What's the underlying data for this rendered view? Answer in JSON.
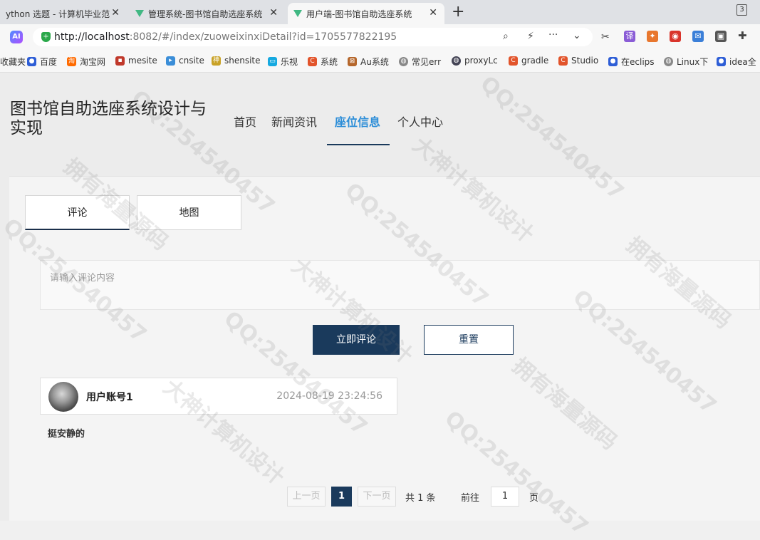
{
  "browser": {
    "tabs": [
      {
        "title": "ython 选题 - 计算机毕业范",
        "close": "✕"
      },
      {
        "title": "管理系统-图书馆自助选座系统",
        "close": "✕"
      },
      {
        "title": "用户端-图书馆自助选座系统",
        "close": "✕"
      }
    ],
    "new_tab": "+",
    "tab_count": "3",
    "url_host": "http://localhost",
    "url_rest": ":8082/#/index/zuoweixinxiDetail?id=1705577822195",
    "bookmarks": [
      "收藏夹",
      "百度",
      "淘宝网",
      "mesite",
      "cnsite",
      "shensite",
      "乐视",
      "系统",
      "Au系统",
      "常见err",
      "proxyLc",
      "gradle",
      "Studio",
      "在eclips",
      "Linux下",
      "idea全"
    ]
  },
  "site": {
    "title": "图书馆自助选座系统设计与实现",
    "nav": [
      "首页",
      "新闻资讯",
      "座位信息",
      "个人中心"
    ]
  },
  "detail": {
    "tabs": [
      "评论",
      "地图"
    ],
    "comment_placeholder": "请输入评论内容",
    "submit_label": "立即评论",
    "reset_label": "重置",
    "comments": [
      {
        "user": "用户账号1",
        "time": "2024-08-19 23:24:56",
        "text": "挺安静的"
      }
    ],
    "pagination": {
      "prev": "上一页",
      "current": "1",
      "next": "下一页",
      "total": "共 1 条",
      "goto_label": "前往",
      "goto_value": "1",
      "page_suffix": "页"
    }
  },
  "watermarks": [
    "拥有海量源码",
    "QQ:254540457",
    "大神计算机设计"
  ]
}
